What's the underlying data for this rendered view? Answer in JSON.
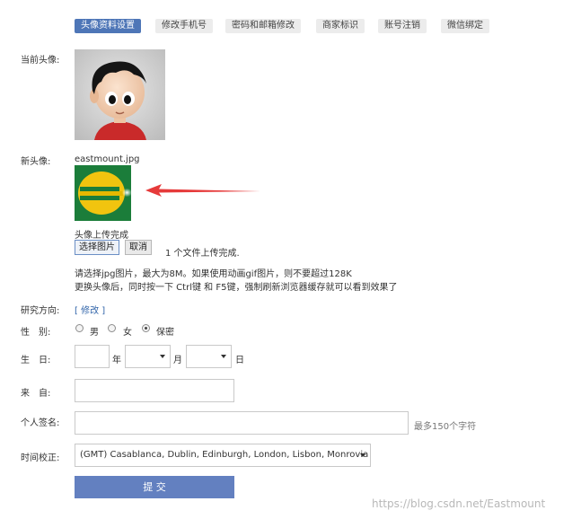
{
  "tabs": [
    {
      "label": "头像资料设置",
      "active": true
    },
    {
      "label": "修改手机号"
    },
    {
      "label": "密码和邮箱修改"
    },
    {
      "label": "商家标识"
    },
    {
      "label": "账号注销"
    },
    {
      "label": "微信绑定"
    }
  ],
  "current_avatar": {
    "label": "当前头像:"
  },
  "new_avatar": {
    "label": "新头像:",
    "filename": "eastmount.jpg",
    "upload_status": "头像上传完成",
    "choose_button": "选择图片",
    "cancel_button": "取消",
    "file_status": "1 个文件上传完成.",
    "hint1": "请选择jpg图片，最大为8M。如果使用动画gif图片，则不要超过128K",
    "hint2": "更换头像后，同时按一下 Ctrl键 和 F5键，强制刷新浏览器缓存就可以看到效果了"
  },
  "research": {
    "label": "研究方向:",
    "link": "[ 修改 ]"
  },
  "gender": {
    "label": "性　别:",
    "options": [
      {
        "label": "男",
        "checked": false
      },
      {
        "label": "女",
        "checked": false
      },
      {
        "label": "保密",
        "checked": true
      }
    ]
  },
  "birthday": {
    "label": "生　日:",
    "year_unit": "年",
    "month_unit": "月",
    "day_unit": "日",
    "year": "",
    "month": "",
    "day": ""
  },
  "from": {
    "label": "来　自:",
    "value": ""
  },
  "signature": {
    "label": "个人签名:",
    "value": "",
    "limit_hint": "最多150个字符"
  },
  "timezone": {
    "label": "时间校正:",
    "selected": "(GMT) Casablanca, Dublin, Edinburgh, London, Lisbon, Monrovia"
  },
  "submit_label": "提 交",
  "watermark": "https://blog.csdn.net/Eastmount",
  "colors": {
    "accent": "#4e76b7",
    "arrow": "#e63a3a",
    "link": "#3366aa"
  }
}
